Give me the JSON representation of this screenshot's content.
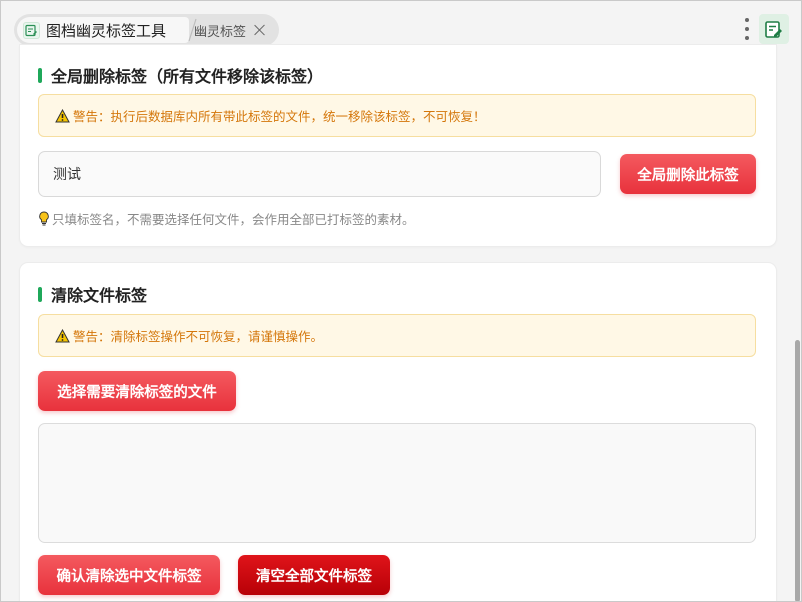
{
  "tabs": [
    {
      "label": "图档幽灵标签工具",
      "icon": "app-icon"
    },
    {
      "label": "幽灵标签",
      "close_icon": "close-icon"
    }
  ],
  "global_delete": {
    "title": "全局删除标签（所有文件移除该标签）",
    "warning": "警告：执行后数据库内所有带此标签的文件，统一移除该标签，不可恢复！",
    "input_value": "测试",
    "button_label": "全局删除此标签",
    "hint": "只填标签名，不需要选择任何文件，会作用全部已打标签的素材。"
  },
  "clear_file_tags": {
    "title": "清除文件标签",
    "warning": "警告：清除标签操作不可恢复，请谨慎操作。",
    "select_button_label": "选择需要清除标签的文件",
    "confirm_button_label": "确认清除选中文件标签",
    "clear_all_button_label": "清空全部文件标签"
  },
  "colors": {
    "accent_green": "#1fa85a",
    "danger_red": "#e8323c",
    "danger_dark_red": "#b80007",
    "warning_text": "#d4760a",
    "warning_bg": "#fff8e6"
  }
}
